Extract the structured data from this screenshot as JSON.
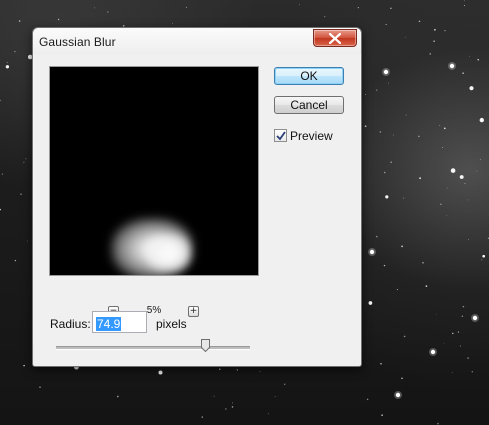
{
  "window": {
    "title": "Gaussian Blur"
  },
  "buttons": {
    "ok": "OK",
    "cancel": "Cancel"
  },
  "preview": {
    "label": "Preview",
    "checked": true
  },
  "zoom": {
    "minus": "−",
    "plus": "+",
    "level": "5%"
  },
  "radius": {
    "label": "Radius:",
    "value": "74.9",
    "unit": "pixels",
    "slider_fraction": 0.77
  },
  "icons": {
    "close": "close-icon",
    "check": "checkmark-icon",
    "zoom_out": "zoom-out-icon",
    "zoom_in": "zoom-in-icon"
  },
  "colors": {
    "close_button": "#d2553f",
    "ok_button_accent": "#3c7fb1",
    "selection": "#3399ff"
  }
}
